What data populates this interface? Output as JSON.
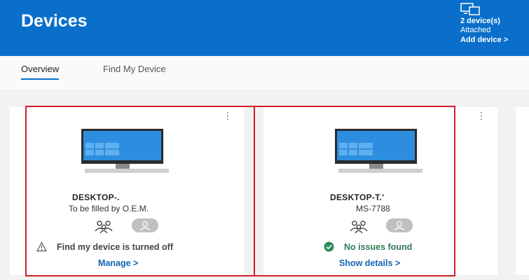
{
  "header": {
    "title": "Devices",
    "device_count": "2 device(s)",
    "attached_label": "Attached",
    "add_device_label": "Add device >",
    "icon": "devices-icon"
  },
  "tabs": [
    {
      "label": "Overview",
      "active": true
    },
    {
      "label": "Find My Device",
      "active": false
    }
  ],
  "devices": [
    {
      "name": "DESKTOP-.",
      "subtitle": "To be filled by O.E.M.",
      "status_text": "Find my device is turned off",
      "status_type": "warning",
      "action_label": "Manage >",
      "more_icon": "⋮"
    },
    {
      "name": "DESKTOP-T.'",
      "subtitle": "MS-7788",
      "status_text": "No issues found",
      "status_type": "ok",
      "action_label": "Show details >",
      "more_icon": "⋮"
    }
  ],
  "colors": {
    "header_bg": "#0a6fcb",
    "accent": "#0a6fcb",
    "link": "#1265b4",
    "ok": "#2f7d55",
    "highlight": "#d01f2d"
  }
}
